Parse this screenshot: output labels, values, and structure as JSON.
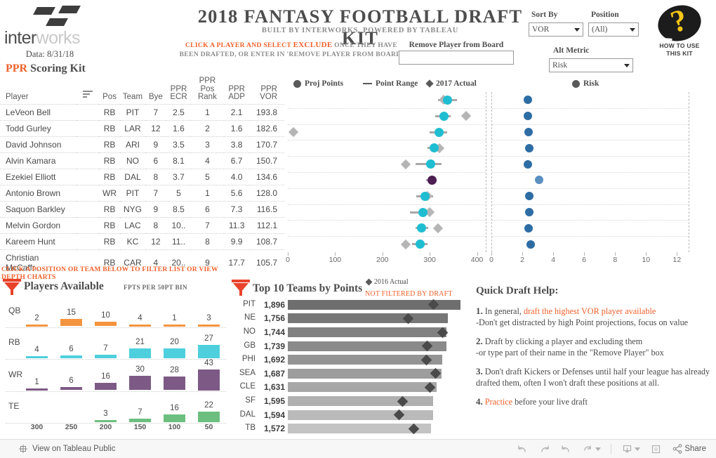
{
  "header": {
    "logo_text_a": "inter",
    "logo_text_b": "works",
    "data_date": "Data: 8/31/18",
    "title": "2018 FANTASY FOOTBALL DRAFT KIT",
    "subtitle": "BUILT BY INTERWORKS, POWERED BY TABLEAU",
    "instruction_pre": "CLICK A PLAYER AND SELECT ",
    "instruction_hl": "EXCLUDE",
    "instruction_post": " ONCE THEY HAVE BEEN DRAFTED, OR ENTER IN 'REMOVE PLAYER FROM BOARD'",
    "remove_label": "Remove Player from Board",
    "remove_value": "",
    "remove_placeholder": "",
    "sort_by_label": "Sort By",
    "sort_by_value": "VOR",
    "position_label": "Position",
    "position_value": "(All)",
    "alt_metric_label": "Alt Metric",
    "alt_metric_value": "Risk",
    "help_badge_text": "HOW TO USE THIS KIT",
    "help_badge_glyph": "?"
  },
  "ppr": {
    "title_hl": "PPR",
    "title_rest": " Scoring Kit"
  },
  "table": {
    "columns": [
      "Player",
      "",
      "Pos",
      "Team",
      "Bye",
      "PPR ECR",
      "PPR Pos Rank",
      "PPR ADP",
      "PPR VOR"
    ],
    "headers": {
      "player": "Player",
      "pos": "Pos",
      "team": "Team",
      "bye": "Bye",
      "ecr_l1": "PPR",
      "ecr_l2": "ECR",
      "rank_l1": "PPR Pos",
      "rank_l2": "Rank",
      "adp_l1": "PPR",
      "adp_l2": "ADP",
      "vor": "PPR VOR"
    },
    "rows": [
      {
        "player": "LeVeon Bell",
        "pos": "RB",
        "team": "PIT",
        "bye": "7",
        "ecr": "2.5",
        "rank": "1",
        "adp": "2.1",
        "vor": "193.8"
      },
      {
        "player": "Todd Gurley",
        "pos": "RB",
        "team": "LAR",
        "bye": "12",
        "ecr": "1.6",
        "rank": "2",
        "adp": "1.6",
        "vor": "182.6"
      },
      {
        "player": "David Johnson",
        "pos": "RB",
        "team": "ARI",
        "bye": "9",
        "ecr": "3.5",
        "rank": "3",
        "adp": "3.8",
        "vor": "170.7"
      },
      {
        "player": "Alvin Kamara",
        "pos": "RB",
        "team": "NO",
        "bye": "6",
        "ecr": "8.1",
        "rank": "4",
        "adp": "6.7",
        "vor": "150.7"
      },
      {
        "player": "Ezekiel Elliott",
        "pos": "RB",
        "team": "DAL",
        "bye": "8",
        "ecr": "3.7",
        "rank": "5",
        "adp": "4.0",
        "vor": "134.6"
      },
      {
        "player": "Antonio Brown",
        "pos": "WR",
        "team": "PIT",
        "bye": "7",
        "ecr": "5",
        "rank": "1",
        "adp": "5.6",
        "vor": "128.0"
      },
      {
        "player": "Saquon Barkley",
        "pos": "RB",
        "team": "NYG",
        "bye": "9",
        "ecr": "8.5",
        "rank": "6",
        "adp": "7.3",
        "vor": "116.5"
      },
      {
        "player": "Melvin Gordon",
        "pos": "RB",
        "team": "LAC",
        "bye": "8",
        "ecr": "10..",
        "rank": "7",
        "adp": "11.3",
        "vor": "112.1"
      },
      {
        "player": "Kareem Hunt",
        "pos": "RB",
        "team": "KC",
        "bye": "12",
        "ecr": "11..",
        "rank": "8",
        "adp": "9.9",
        "vor": "108.7"
      },
      {
        "player": "Christian McCaffr..",
        "pos": "RB",
        "team": "CAR",
        "bye": "4",
        "ecr": "20..",
        "rank": "9",
        "adp": "17.7",
        "vor": "105.7"
      }
    ]
  },
  "plot_legend": {
    "proj_points": "Proj Points",
    "point_range": "Point Range",
    "actual_2017": "2017 Actual",
    "risk": "Risk"
  },
  "colors": {
    "orange": "#f0612b",
    "cyan": "#1fbdd1",
    "purple": "#4c1f52",
    "gray_marker": "#b5b5b5",
    "risk_blue": "#2e6da4",
    "qb_orange": "#f4943f",
    "rb_cyan": "#4ecfdd",
    "wr_purple": "#7d5a85",
    "te_green": "#6cbf7e"
  },
  "chart_data": [
    {
      "type": "scatter",
      "name": "proj-points-dotplot",
      "title": "",
      "xlabel": "",
      "xlim": [
        0,
        420
      ],
      "xticks": [
        0,
        100,
        200,
        300,
        400
      ],
      "grid": true,
      "legend": [
        "Proj Points",
        "Point Range",
        "2017 Actual"
      ],
      "categories": [
        "LeVeon Bell",
        "Todd Gurley",
        "David Johnson",
        "Alvin Kamara",
        "Ezekiel Elliott",
        "Antonio Brown",
        "Saquon Barkley",
        "Melvin Gordon",
        "Kareem Hunt",
        "Christian McCaffr.."
      ],
      "series": [
        {
          "name": "Proj Points",
          "values": [
            338,
            330,
            320,
            310,
            302,
            305,
            290,
            285,
            283,
            280
          ]
        },
        {
          "name": "Range Low",
          "values": [
            318,
            312,
            300,
            295,
            270,
            292,
            272,
            258,
            270,
            262
          ]
        },
        {
          "name": "Range High",
          "values": [
            357,
            345,
            337,
            322,
            325,
            315,
            307,
            305,
            297,
            295
          ]
        },
        {
          "name": "2017 Actual",
          "values": [
            330,
            377,
            12,
            320,
            250,
            null,
            295,
            300,
            318,
            250
          ]
        }
      ]
    },
    {
      "type": "scatter",
      "name": "risk-dotplot",
      "title": "Risk",
      "xlabel": "",
      "xlim": [
        0,
        12.8
      ],
      "xticks": [
        0,
        2,
        4,
        6,
        8,
        10,
        12
      ],
      "grid": true,
      "legend": [
        "Risk"
      ],
      "categories": [
        "LeVeon Bell",
        "Todd Gurley",
        "David Johnson",
        "Alvin Kamara",
        "Ezekiel Elliott",
        "Antonio Brown",
        "Saquon Barkley",
        "Melvin Gordon",
        "Kareem Hunt",
        "Christian McCaffr.."
      ],
      "values": [
        2.3,
        2.3,
        2.35,
        2.4,
        2.3,
        3.05,
        2.4,
        2.4,
        2.35,
        2.5
      ]
    },
    {
      "type": "bar",
      "name": "players-available",
      "title": "Players Available",
      "subtitle": "FPTS PER 50PT BIN",
      "xlabel": "",
      "ylabel": "",
      "categories": [
        "300",
        "250",
        "200",
        "150",
        "100",
        "50"
      ],
      "series": [
        {
          "name": "QB",
          "values": [
            2,
            15,
            10,
            4,
            1,
            3
          ],
          "color": "#f4943f"
        },
        {
          "name": "RB",
          "values": [
            4,
            6,
            7,
            21,
            20,
            27
          ],
          "color": "#4ecfdd"
        },
        {
          "name": "WR",
          "values": [
            1,
            6,
            16,
            30,
            28,
            43
          ],
          "color": "#7d5a85"
        },
        {
          "name": "TE",
          "values": [
            0,
            0,
            3,
            7,
            16,
            22
          ],
          "color": "#6cbf7e"
        }
      ]
    },
    {
      "type": "bar",
      "name": "top-10-teams-by-points",
      "title": "Top 10 Teams by Points",
      "note": "NOT FILTERED BY DRAFT",
      "legend": [
        "2016 Actual"
      ],
      "categories": [
        "PIT",
        "NE",
        "NO",
        "GB",
        "PHI",
        "SEA",
        "CLE",
        "SF",
        "DAL",
        "TB"
      ],
      "values": [
        1896,
        1756,
        1744,
        1739,
        1692,
        1687,
        1631,
        1595,
        1594,
        1572
      ],
      "marker_2016": [
        1600,
        1320,
        1700,
        1530,
        1520,
        1620,
        1560,
        1260,
        1220,
        1380
      ],
      "xlim": [
        0,
        1950
      ]
    }
  ],
  "players_available": {
    "filter_note": "CLICK A POSITION OR TEAM BELOW TO FILTER LIST OR VIEW DEPTH CHARTS",
    "title": "Players Available",
    "subtitle": "FPTS PER 50PT BIN",
    "positions": [
      "QB",
      "RB",
      "WR",
      "TE"
    ],
    "axis_labels": [
      "300",
      "250",
      "200",
      "150",
      "100",
      "50"
    ]
  },
  "top10": {
    "title": "Top 10 Teams by Points",
    "legend_label": "2016 Actual",
    "note": "NOT FILTERED BY DRAFT",
    "rows": [
      {
        "team": "PIT",
        "points": "1,896"
      },
      {
        "team": "NE",
        "points": "1,756"
      },
      {
        "team": "NO",
        "points": "1,744"
      },
      {
        "team": "GB",
        "points": "1,739"
      },
      {
        "team": "PHI",
        "points": "1,692"
      },
      {
        "team": "SEA",
        "points": "1,687"
      },
      {
        "team": "CLE",
        "points": "1,631"
      },
      {
        "team": "SF",
        "points": "1,595"
      },
      {
        "team": "DAL",
        "points": "1,594"
      },
      {
        "team": "TB",
        "points": "1,572"
      }
    ]
  },
  "help": {
    "title": "Quick Draft Help:",
    "items": [
      {
        "num": "1.",
        "pre": " In general, ",
        "hl": "draft the highest VOR player available",
        "sub": "-Don't get distracted by high Point projections, focus on value"
      },
      {
        "num": "2.",
        "pre": " Draft by clicking a player and excluding them",
        "hl": "",
        "sub": "   -or type part of their name in the \"Remove Player\" box"
      },
      {
        "num": "3.",
        "pre": " Don't draft Kickers or Defenses until half your league has already drafted them, often I won't draft these positions at all.",
        "hl": "",
        "sub": ""
      },
      {
        "num": "4.",
        "pre": " ",
        "hl": "Practice",
        "sub": "",
        "post": " before your live draft"
      }
    ]
  },
  "bottombar": {
    "view_label": "View on Tableau Public",
    "share_label": "Share",
    "icons": [
      "undo-icon",
      "redo-icon",
      "revert-icon",
      "refresh-icon",
      "pause-icon",
      "download-icon",
      "fullscreen-icon",
      "share-icon"
    ]
  }
}
